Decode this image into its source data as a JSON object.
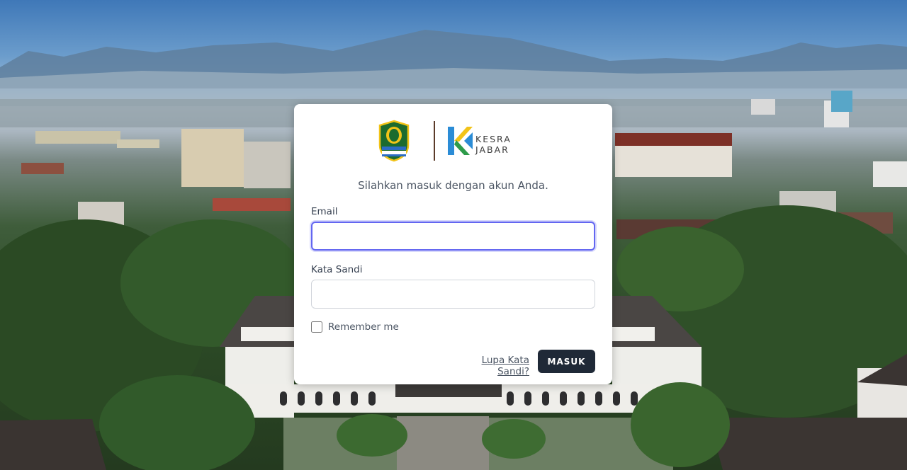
{
  "background": {
    "description_icon": "city-aerial-photo"
  },
  "logos": {
    "left_icon": "west-java-emblem-icon",
    "right_icon": "kesra-jabar-logo-icon",
    "brand_line1": "KESRA",
    "brand_line2": "JABAR"
  },
  "login": {
    "subtitle": "Silahkan masuk dengan akun Anda.",
    "email_label": "Email",
    "email_value": "",
    "password_label": "Kata Sandi",
    "password_value": "",
    "remember_label": "Remember me",
    "remember_checked": false,
    "forgot_label": "Lupa Kata Sandi?",
    "submit_label": "MASUK"
  },
  "colors": {
    "accent": "#6366f1",
    "button": "#1f2937",
    "brand_green": "#2e9b4a",
    "brand_blue": "#2b8cd6",
    "brand_yellow": "#f2c318"
  }
}
